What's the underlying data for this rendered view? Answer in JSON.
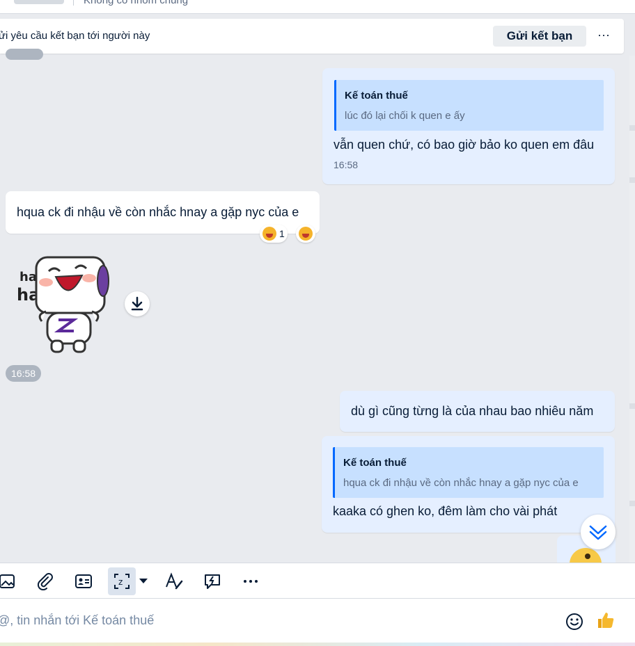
{
  "header": {
    "group_label": "Không có nhóm chung"
  },
  "friend_request": {
    "message": "ửi yêu cầu kết bạn tới người này",
    "button_label": "Gửi kết bạn",
    "more_label": "···"
  },
  "messages": {
    "msg1": {
      "quote_name": "Kế toán thuế",
      "quote_text": "lúc đó lại chối k quen e ấy",
      "text": "vẫn quen chứ, có bao giờ bảo ko quen em đâu",
      "time": "16:58"
    },
    "msg2": {
      "text": "hqua ck đi nhậu về còn nhắc hnay a gặp nyc của e",
      "reaction_count": "1"
    },
    "sticker_time": "16:58",
    "msg3": {
      "text": "dù gì cũng từng là của nhau bao nhiêu năm"
    },
    "msg4": {
      "quote_name": "Kế toán thuế",
      "quote_text": "hqua ck đi nhậu về còn nhắc hnay a gặp nyc của e",
      "text": "kaaka có ghen ko, đêm làm cho vài phát"
    }
  },
  "composer": {
    "placeholder": "@, tin nhắn tới Kế toán thuế"
  },
  "toolbar": {
    "icons": [
      "image-icon",
      "attach-icon",
      "contact-card-icon",
      "screenshot-icon",
      "format-text-icon",
      "quick-message-icon",
      "more-icon"
    ]
  },
  "colors": {
    "accent": "#0068ff",
    "my_bubble": "#e5efff",
    "quote_bg": "#c7e0ff",
    "chat_bg": "#e9ebef"
  }
}
